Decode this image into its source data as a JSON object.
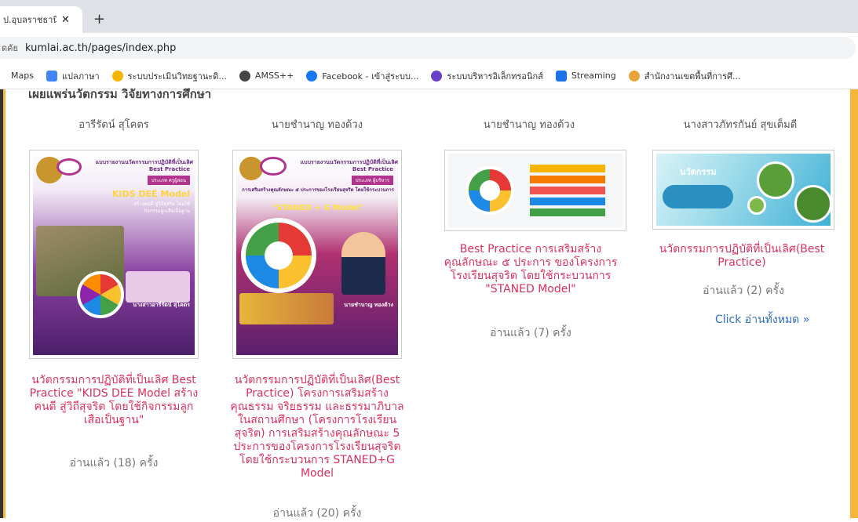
{
  "browser": {
    "tab_title": "ป.อุบลราชธานี",
    "tab_close": "✕",
    "new_tab": "+",
    "lock_label": "ดคัย",
    "url": "kumlai.ac.th/pages/index.php",
    "bookmarks": [
      {
        "label": "Maps",
        "color": "#34a853"
      },
      {
        "label": "แปลภาษา",
        "color": "#4285f4"
      },
      {
        "label": "ระบบประเมินวิทยฐานะดิ...",
        "color": "#f4b400"
      },
      {
        "label": "AMSS++",
        "color": "#444444"
      },
      {
        "label": "Facebook - เข้าสู่ระบบ...",
        "color": "#1877f2"
      },
      {
        "label": "ระบบบริหารอิเล็กทรอนิกส์",
        "color": "#6a3fc7"
      },
      {
        "label": "Streaming",
        "color": "#1a73e8"
      },
      {
        "label": "สำนักงานเขตพื้นที่การศึ...",
        "color": "#e8a23a"
      }
    ]
  },
  "section_title": "เผยแพร่นวัตกรรม วิจัยทางการศึกษา",
  "items": [
    {
      "author": "อารีรัตน์ สุโคตร",
      "cover_text": {
        "header": "แบบรายงานนวัตกรรมการปฏิบัติที่เป็นเลิศ",
        "bp": "Best Practice",
        "type": "ประเภท ครูผู้สอน",
        "model": "KIDS DEE Model",
        "sub": "สร้างคนดี สู่วิถีสุจริต โดยใช้กิจกรรมลูกเสือเป็นฐาน",
        "name": "นางสาวอารีรัตน์ สุโคตร"
      },
      "title": "นวัตกรรมการปฏิบัติที่เป็นเลิศ Best Practice \"KIDS DEE Model สร้างคนดี สู่วิถีสุจริต โดยใช้กิจกรรมลูกเสือเป็นฐาน\"",
      "reads": "อ่านแล้ว (18) ครั้ง"
    },
    {
      "author": "นายชำนาญ ทองด้วง",
      "cover_text": {
        "header": "แบบรายงานนวัตกรรมการปฏิบัติที่เป็นเลิศ",
        "bp": "Best Practice",
        "type": "ประเภท ผู้บริหาร",
        "sub": "การเสริมสร้างคุณลักษณะ ๕ ประการของโรงเรียนสุจริต โดยใช้กระบวนการ",
        "model": "\"STANED + G Model\"",
        "name": "นายชำนาญ ทองด้วง"
      },
      "title": "นวัตกรรมการปฏิบัติที่เป็นเลิศ(Best Practice) โครงการเสริมสร้างคุณธรรม จริยธรรม และธรรมาภิบาลในสถานศึกษา (โครงการโรงเรียนสุจริต) การเสริมสร้างคุณลักษณะ 5 ประการของโครงการโรงเรียนสุจริต โดยใช้กระบวนการ STANED+G Model",
      "reads": "อ่านแล้ว (20) ครั้ง"
    },
    {
      "author": "นายชำนาญ ทองด้วง",
      "title": "Best Practice การเสริมสร้างคุณลักษณะ ๕ ประการ ของโครงการโรงเรียนสุจริต โดยใช้กระบวนการ \"STANED Model\"",
      "reads": "อ่านแล้ว (7) ครั้ง"
    },
    {
      "author": "นางสาวภัทรกันย์ สุขเต็มดี",
      "cover_text": {
        "label": "นวัตกรรม"
      },
      "title": "นวัตกรรมการปฏิบัติที่เป็นเลิศ(Best Practice)",
      "reads": "อ่านแล้ว (2) ครั้ง",
      "more": "Click อ่านทั้งหมด »"
    }
  ],
  "colors": {
    "accent": "#f4b73a",
    "title": "#d9315f",
    "link": "#2f6fbf"
  }
}
